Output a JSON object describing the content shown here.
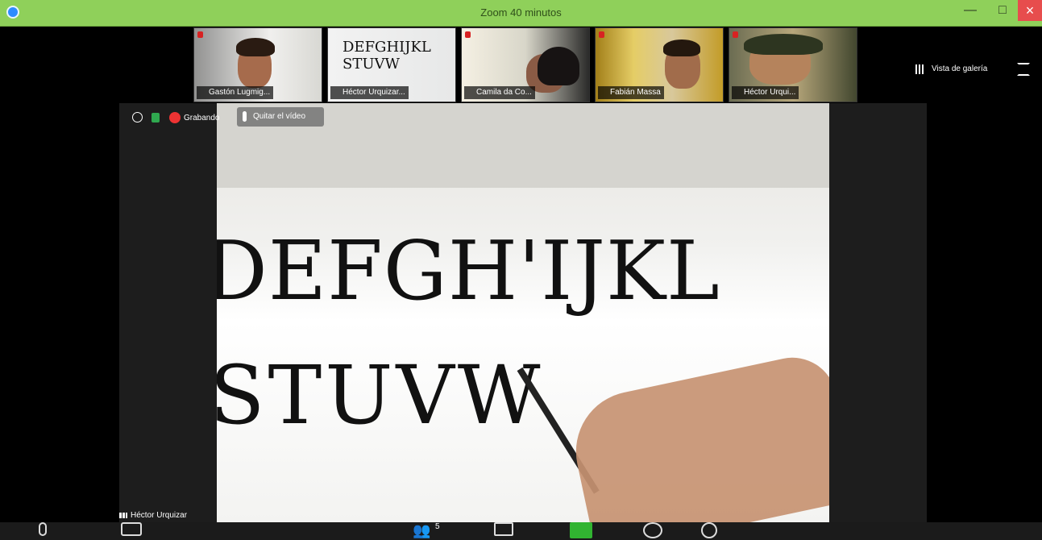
{
  "window": {
    "title": "Zoom 40 minutos"
  },
  "gallery": {
    "participants": [
      {
        "name": "Gastón Lugmig..."
      },
      {
        "name": "Héctor Urquizar..."
      },
      {
        "name": "Camila da Co..."
      },
      {
        "name": "Fabián Massa"
      },
      {
        "name": "Héctor Urqui..."
      }
    ]
  },
  "main_video": {
    "recording_label": "Grabando",
    "stop_video_label": "Quitar el vídeo",
    "speaker_name": "Héctor Urquizar",
    "writing_line1": "DEFGH'IJKL",
    "writing_line2": "STUVW"
  },
  "controls": {
    "gallery_view_label": "Vista de galería",
    "participant_count": "5"
  },
  "colors": {
    "titlebar": "#8fd05a",
    "close_button": "#e74d4d",
    "share_button": "#31b431"
  }
}
